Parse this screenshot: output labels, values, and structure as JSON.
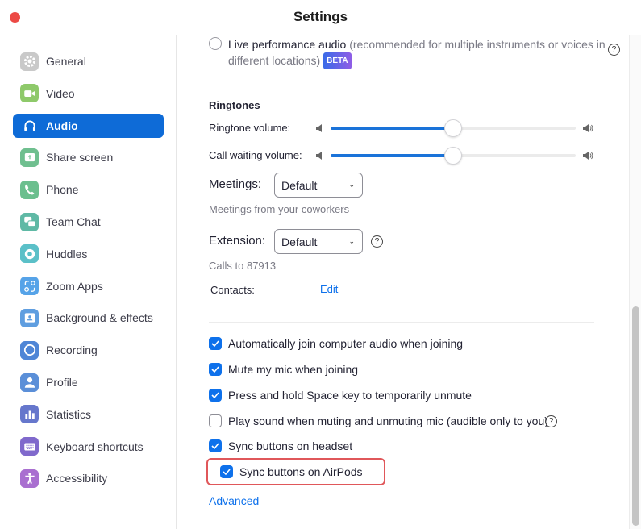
{
  "window": {
    "title": "Settings"
  },
  "sidebar": {
    "items": [
      {
        "label": "General",
        "icon": "gear-icon",
        "color": "#c9c9c9",
        "active": false
      },
      {
        "label": "Video",
        "icon": "video-camera-icon",
        "color": "#8ec96a",
        "active": false
      },
      {
        "label": "Audio",
        "icon": "headphones-icon",
        "color": "#0e6bd7",
        "active": true
      },
      {
        "label": "Share screen",
        "icon": "share-screen-icon",
        "color": "#6fbf8f",
        "active": false
      },
      {
        "label": "Phone",
        "icon": "phone-icon",
        "color": "#6bbf8e",
        "active": false
      },
      {
        "label": "Team Chat",
        "icon": "chat-bubbles-icon",
        "color": "#5fb9a5",
        "active": false
      },
      {
        "label": "Huddles",
        "icon": "huddles-icon",
        "color": "#5bc0c8",
        "active": false
      },
      {
        "label": "Zoom Apps",
        "icon": "apps-icon",
        "color": "#56a3e8",
        "active": false
      },
      {
        "label": "Background & effects",
        "icon": "background-icon",
        "color": "#5f9ee0",
        "active": false
      },
      {
        "label": "Recording",
        "icon": "recording-icon",
        "color": "#4f86d6",
        "active": false
      },
      {
        "label": "Profile",
        "icon": "profile-icon",
        "color": "#5b8fd8",
        "active": false
      },
      {
        "label": "Statistics",
        "icon": "statistics-icon",
        "color": "#6677cc",
        "active": false
      },
      {
        "label": "Keyboard shortcuts",
        "icon": "keyboard-icon",
        "color": "#8069cc",
        "active": false
      },
      {
        "label": "Accessibility",
        "icon": "accessibility-icon",
        "color": "#a96fd0",
        "active": false
      }
    ]
  },
  "audio": {
    "live_performance": {
      "label_main": "Live performance audio",
      "label_note_line1": " (recommended for multiple instruments or voices in",
      "label_note_line2": "different locations)",
      "badge": "BETA",
      "selected": false
    },
    "ringtones": {
      "heading": "Ringtones",
      "ringtone_volume_label": "Ringtone volume:",
      "ringtone_volume": 0.5,
      "call_waiting_label": "Call waiting volume:",
      "call_waiting_volume": 0.5
    },
    "meetings": {
      "label": "Meetings:",
      "value": "Default",
      "caption": "Meetings from your coworkers"
    },
    "extension": {
      "label": "Extension:",
      "value": "Default",
      "caption": "Calls to 87913"
    },
    "contacts": {
      "label": "Contacts:",
      "action": "Edit"
    },
    "options": [
      {
        "label": "Automatically join computer audio when joining",
        "checked": true,
        "help": false
      },
      {
        "label": "Mute my mic when joining",
        "checked": true,
        "help": false
      },
      {
        "label": "Press and hold Space key to temporarily unmute",
        "checked": true,
        "help": false
      },
      {
        "label": "Play sound when muting and unmuting mic (audible only to you)",
        "checked": false,
        "help": true
      },
      {
        "label": "Sync buttons on headset",
        "checked": true,
        "help": false
      },
      {
        "label": "Sync buttons on AirPods",
        "checked": true,
        "help": false,
        "highlighted": true
      }
    ],
    "advanced_link": "Advanced"
  },
  "help_glyph": "?",
  "chevron_glyph": "⌄",
  "colors": {
    "accent": "#0e71eb",
    "highlight_border": "#e0575a",
    "close": "#ec4a45"
  }
}
